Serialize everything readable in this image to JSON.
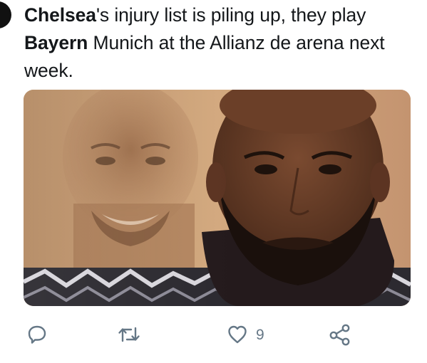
{
  "tweet": {
    "text_part1": "Chelsea",
    "text_part2": "'s injury list is piling up, they play ",
    "text_part3": "Bayern",
    "text_part4": " Munich at the Allianz de arena next week."
  },
  "actions": {
    "reply_icon": "reply-icon",
    "retweet_icon": "retweet-icon",
    "like_icon": "heart-icon",
    "like_count": "9",
    "share_icon": "share-icon"
  },
  "colors": {
    "text": "#14171a",
    "icon": "#657786"
  }
}
